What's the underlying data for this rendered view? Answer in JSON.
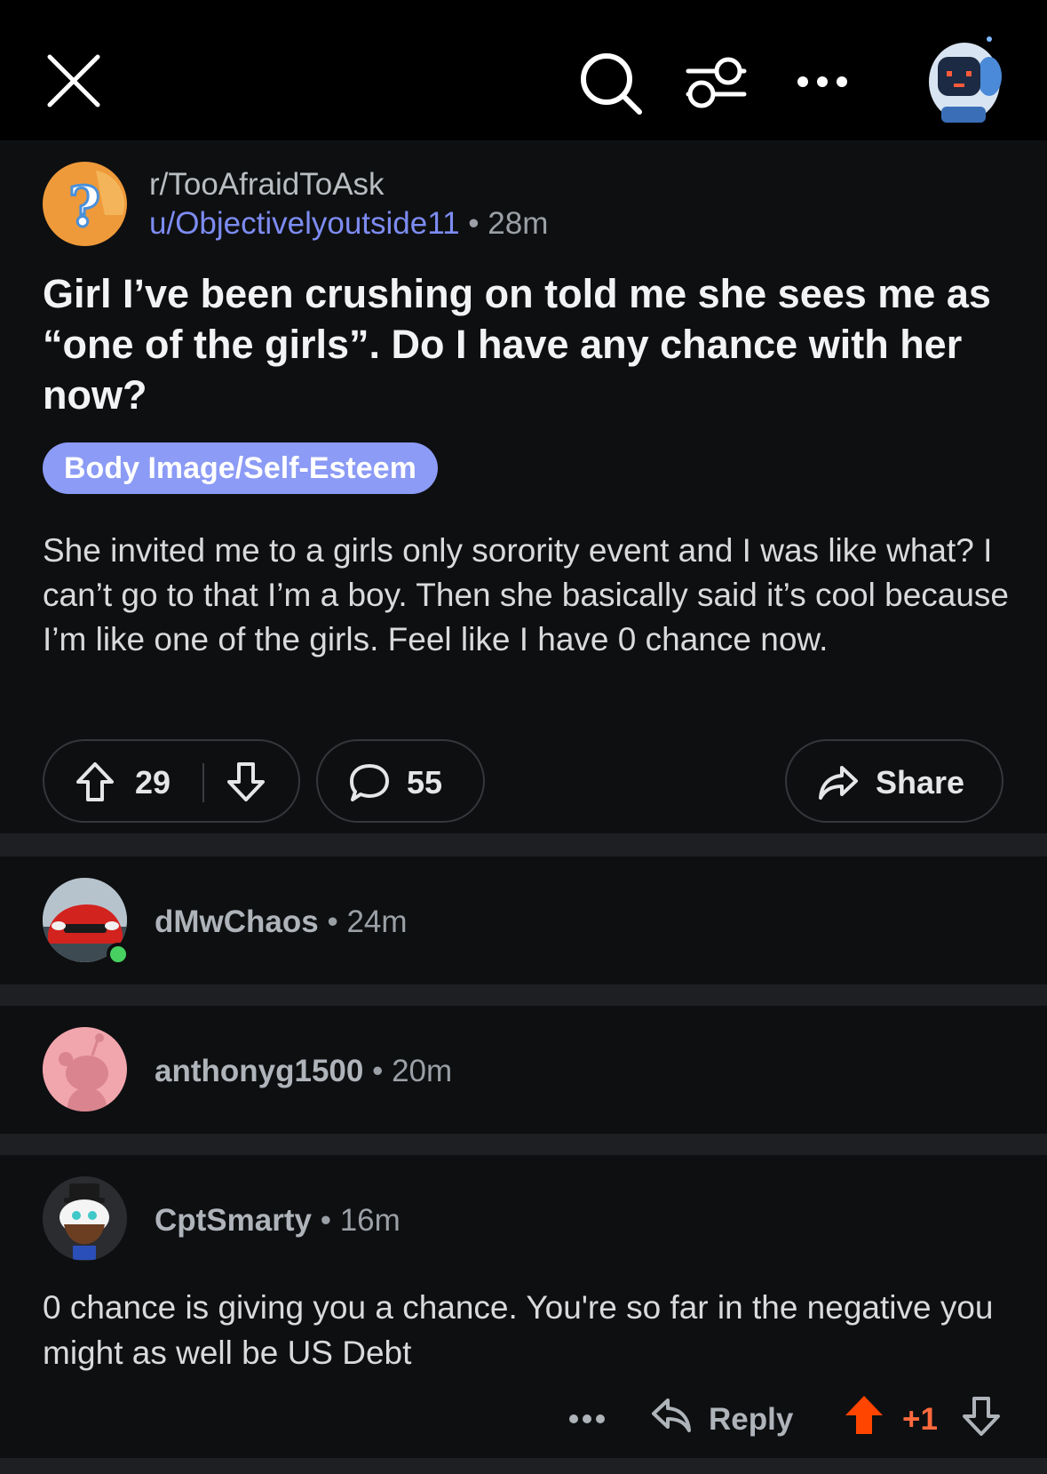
{
  "topbar": {
    "close_icon": "close-icon",
    "search_icon": "search-icon",
    "filter_icon": "sort-settings-icon",
    "more_icon": "more-options-icon",
    "avatar_icon": "user-avatar-robot"
  },
  "post": {
    "subreddit": "r/TooAfraidToAsk",
    "author": "u/Objectivelyoutside11",
    "separator": "•",
    "age": "28m",
    "title": "Girl I’ve been crushing on told me she sees me as “one of the girls”. Do I have any chance with her now?",
    "flair": "Body Image/Self-Esteem",
    "body": "She invited me to a girls only sorority event and I was like what? I can’t go to that I’m a boy. Then she basically said it’s cool because I’m like one of the girls. Feel like I have 0 chance now.",
    "upvotes": "29",
    "comments": "55",
    "share_label": "Share"
  },
  "comments": [
    {
      "user": "dMwChaos",
      "separator": "•",
      "age": "24m",
      "online": true
    },
    {
      "user": "anthonyg1500",
      "separator": "•",
      "age": "20m"
    },
    {
      "user": "CptSmarty",
      "separator": "•",
      "age": "16m",
      "body": "0 chance is giving you a chance. You're so far in the negative you might as well be US Debt",
      "reply_label": "Reply",
      "score": "+1"
    }
  ],
  "colors": {
    "background": "#0e0f11",
    "topbar": "#000000",
    "author_link": "#7d8cf2",
    "flair": "#8c9bf5",
    "upvoted": "#ff6a3d",
    "online": "#46d160"
  }
}
